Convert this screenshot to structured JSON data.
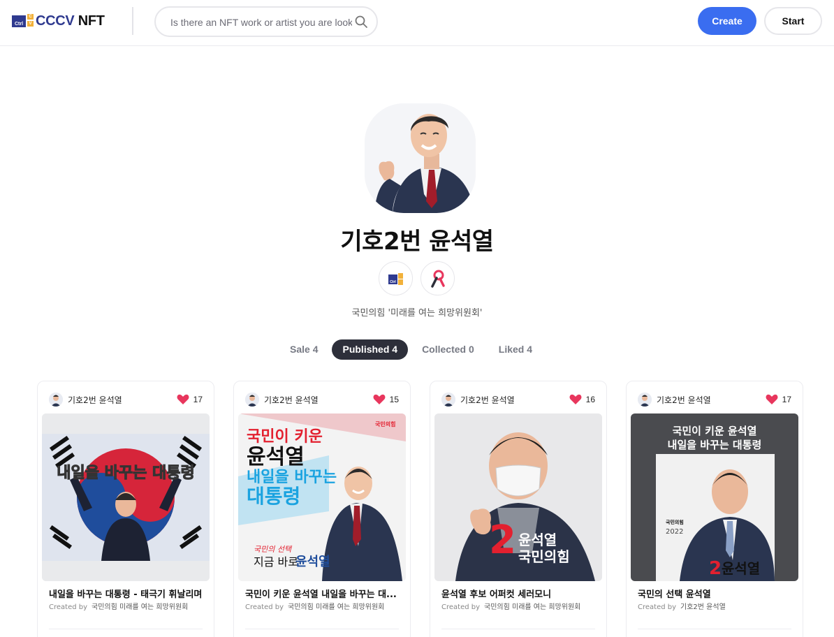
{
  "header": {
    "logo_ctrl": "Ctrl",
    "logo_c": "C",
    "logo_v": "V",
    "logo_brand": "CCCV",
    "logo_suffix": " NFT",
    "search_placeholder": "Is there an NFT work or artist you are looking for?",
    "create_label": "Create",
    "start_label": "Start"
  },
  "profile": {
    "name": "기호2번 윤석열",
    "description": "국민의힘 '미래를 여는 희망위원회'",
    "badges": [
      "cccv-badge-icon",
      "ribbon-badge-icon"
    ]
  },
  "tabs": [
    {
      "label": "Sale 4",
      "active": false
    },
    {
      "label": "Published 4",
      "active": true
    },
    {
      "label": "Collected 0",
      "active": false
    },
    {
      "label": "Liked 4",
      "active": false
    }
  ],
  "cards": [
    {
      "owner": "기호2번 윤석열",
      "likes": "17",
      "title": "내일을 바꾸는 대통령 - 태극기 휘날리며",
      "created_label": "Created by",
      "creator": "국민의힘 미래를 여는 희망위원회",
      "art_text": "내일을 바꾸는 대통령"
    },
    {
      "owner": "기호2번 윤석열",
      "likes": "15",
      "title": "국민이 키운 윤석열 내일을 바꾸는 대...",
      "created_label": "Created by",
      "creator": "국민의힘 미래를 여는 희망위원회",
      "art_line1": "국민이 키운",
      "art_line2": "윤석열",
      "art_line3": "내일을 바꾸는",
      "art_line4": "대통령",
      "art_party": "국민의힘",
      "art_bottom_small": "국민의 선택",
      "art_bottom1": "지금 바로",
      "art_bottom2": "윤석열"
    },
    {
      "owner": "기호2번 윤석열",
      "likes": "16",
      "title": "윤석열 후보 어퍼컷 세러모니",
      "created_label": "Created by",
      "creator": "국민의힘 미래를 여는 희망위원회",
      "art_num": "2",
      "art_line1": "윤석열",
      "art_line2": "국민의힘"
    },
    {
      "owner": "기호2번 윤석열",
      "likes": "17",
      "title": "국민의 선택 윤석열",
      "created_label": "Created by",
      "creator": "기호2번 윤석열",
      "art_line1": "국민이 키운 윤석열",
      "art_line2": "내일을 바꾸는 대통령",
      "art_num": "2",
      "art_name": "윤석열",
      "art_party": "국민의힘",
      "art_year": "2022"
    }
  ],
  "colors": {
    "accent": "#3a6df0",
    "brand_navy": "#2f3a8f",
    "brand_yellow": "#f2b13a",
    "heart": "#e8365d",
    "party_red": "#e3202f",
    "active_tab": "#2d2f3a"
  }
}
